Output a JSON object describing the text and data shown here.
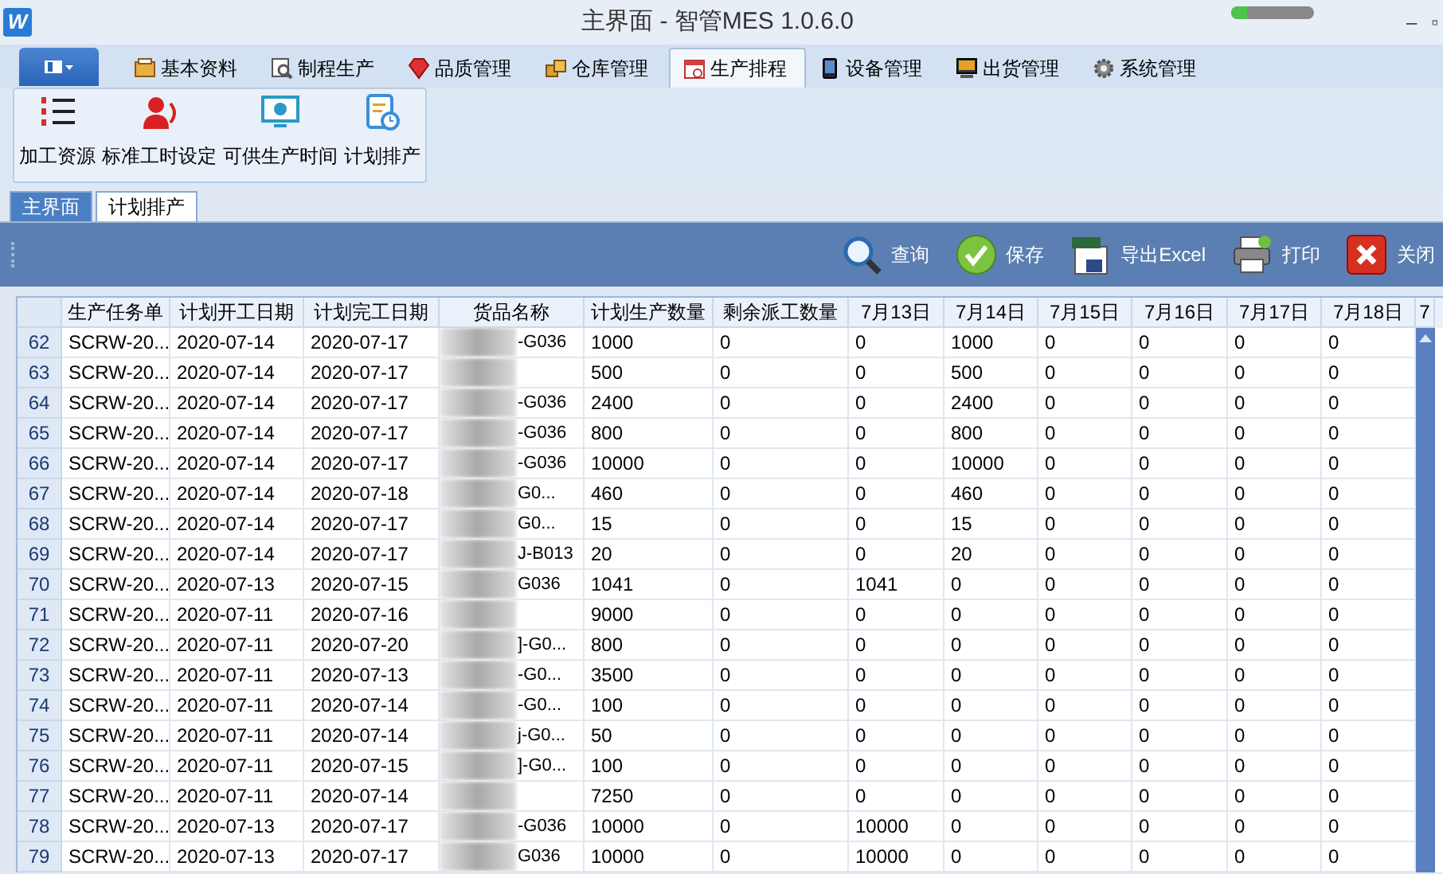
{
  "window": {
    "logo": "W",
    "title": "主界面 - 智管MES 1.0.6.0",
    "meter": {
      "level": 0.2
    },
    "controls": [
      "–",
      "▫"
    ]
  },
  "menu_tabs": [
    {
      "label": "基本资料",
      "selected": false,
      "kind": "book"
    },
    {
      "label": "制程生产",
      "selected": false,
      "kind": "search"
    },
    {
      "label": "品质管理",
      "selected": false,
      "kind": "gem"
    },
    {
      "label": "仓库管理",
      "selected": false,
      "kind": "boxes"
    },
    {
      "label": "生产排程",
      "selected": true,
      "kind": "calendar"
    },
    {
      "label": "设备管理",
      "selected": false,
      "kind": "phone"
    },
    {
      "label": "出货管理",
      "selected": false,
      "kind": "monitor"
    },
    {
      "label": "系统管理",
      "selected": false,
      "kind": "gear"
    }
  ],
  "ribbon": [
    {
      "label": "加工资源",
      "kind": "list"
    },
    {
      "label": "标准工时设定",
      "kind": "person"
    },
    {
      "label": "可供生产时间",
      "kind": "screen"
    },
    {
      "label": "计划排产",
      "kind": "clock"
    }
  ],
  "doc_tabs": [
    {
      "label": "主界面",
      "selected": false
    },
    {
      "label": "计划排产",
      "selected": true
    }
  ],
  "toolbar": [
    {
      "label": "查询",
      "kind": "search"
    },
    {
      "label": "保存",
      "kind": "check"
    },
    {
      "label": "导出Excel",
      "kind": "excel"
    },
    {
      "label": "打印",
      "kind": "printer"
    },
    {
      "label": "关闭",
      "kind": "close"
    }
  ],
  "table": {
    "columns": [
      "生产任务单",
      "计划开工日期",
      "计划完工日期",
      "货品名称",
      "计划生产数量",
      "剩余派工数量",
      "7月13日",
      "7月14日",
      "7月15日",
      "7月16日",
      "7月17日",
      "7月18日",
      "7"
    ],
    "rows": [
      {
        "num": "62",
        "cells": [
          "SCRW-20...",
          "2020-07-14",
          "2020-07-17",
          "-G036",
          "1000",
          "0",
          "0",
          "1000",
          "0",
          "0",
          "0",
          "0"
        ]
      },
      {
        "num": "63",
        "cells": [
          "SCRW-20...",
          "2020-07-14",
          "2020-07-17",
          null,
          "500",
          "0",
          "0",
          "500",
          "0",
          "0",
          "0",
          "0"
        ]
      },
      {
        "num": "64",
        "cells": [
          "SCRW-20...",
          "2020-07-14",
          "2020-07-17",
          "-G036",
          "2400",
          "0",
          "0",
          "2400",
          "0",
          "0",
          "0",
          "0"
        ]
      },
      {
        "num": "65",
        "cells": [
          "SCRW-20...",
          "2020-07-14",
          "2020-07-17",
          "-G036",
          "800",
          "0",
          "0",
          "800",
          "0",
          "0",
          "0",
          "0"
        ]
      },
      {
        "num": "66",
        "cells": [
          "SCRW-20...",
          "2020-07-14",
          "2020-07-17",
          "-G036",
          "10000",
          "0",
          "0",
          "10000",
          "0",
          "0",
          "0",
          "0"
        ]
      },
      {
        "num": "67",
        "cells": [
          "SCRW-20...",
          "2020-07-14",
          "2020-07-18",
          "G0...",
          "460",
          "0",
          "0",
          "460",
          "0",
          "0",
          "0",
          "0"
        ]
      },
      {
        "num": "68",
        "cells": [
          "SCRW-20...",
          "2020-07-14",
          "2020-07-17",
          "G0...",
          "15",
          "0",
          "0",
          "15",
          "0",
          "0",
          "0",
          "0"
        ]
      },
      {
        "num": "69",
        "cells": [
          "SCRW-20...",
          "2020-07-14",
          "2020-07-17",
          "J-B013",
          "20",
          "0",
          "0",
          "20",
          "0",
          "0",
          "0",
          "0"
        ]
      },
      {
        "num": "70",
        "cells": [
          "SCRW-20...",
          "2020-07-13",
          "2020-07-15",
          "G036",
          "1041",
          "0",
          "1041",
          "0",
          "0",
          "0",
          "0",
          "0"
        ]
      },
      {
        "num": "71",
        "cells": [
          "SCRW-20...",
          "2020-07-11",
          "2020-07-16",
          null,
          "9000",
          "0",
          "0",
          "0",
          "0",
          "0",
          "0",
          "0"
        ]
      },
      {
        "num": "72",
        "cells": [
          "SCRW-20...",
          "2020-07-11",
          "2020-07-20",
          "]-G0...",
          "800",
          "0",
          "0",
          "0",
          "0",
          "0",
          "0",
          "0"
        ]
      },
      {
        "num": "73",
        "cells": [
          "SCRW-20...",
          "2020-07-11",
          "2020-07-13",
          "-G0...",
          "3500",
          "0",
          "0",
          "0",
          "0",
          "0",
          "0",
          "0"
        ]
      },
      {
        "num": "74",
        "cells": [
          "SCRW-20...",
          "2020-07-11",
          "2020-07-14",
          "-G0...",
          "100",
          "0",
          "0",
          "0",
          "0",
          "0",
          "0",
          "0"
        ]
      },
      {
        "num": "75",
        "cells": [
          "SCRW-20...",
          "2020-07-11",
          "2020-07-14",
          "j-G0...",
          "50",
          "0",
          "0",
          "0",
          "0",
          "0",
          "0",
          "0"
        ]
      },
      {
        "num": "76",
        "cells": [
          "SCRW-20...",
          "2020-07-11",
          "2020-07-15",
          "]-G0...",
          "100",
          "0",
          "0",
          "0",
          "0",
          "0",
          "0",
          "0"
        ]
      },
      {
        "num": "77",
        "cells": [
          "SCRW-20...",
          "2020-07-11",
          "2020-07-14",
          null,
          "7250",
          "0",
          "0",
          "0",
          "0",
          "0",
          "0",
          "0"
        ]
      },
      {
        "num": "78",
        "cells": [
          "SCRW-20...",
          "2020-07-13",
          "2020-07-17",
          "-G036",
          "10000",
          "0",
          "10000",
          "0",
          "0",
          "0",
          "0",
          "0"
        ]
      },
      {
        "num": "79",
        "cells": [
          "SCRW-20...",
          "2020-07-13",
          "2020-07-17",
          "G036",
          "10000",
          "0",
          "10000",
          "0",
          "0",
          "0",
          "0",
          "0"
        ]
      }
    ]
  }
}
